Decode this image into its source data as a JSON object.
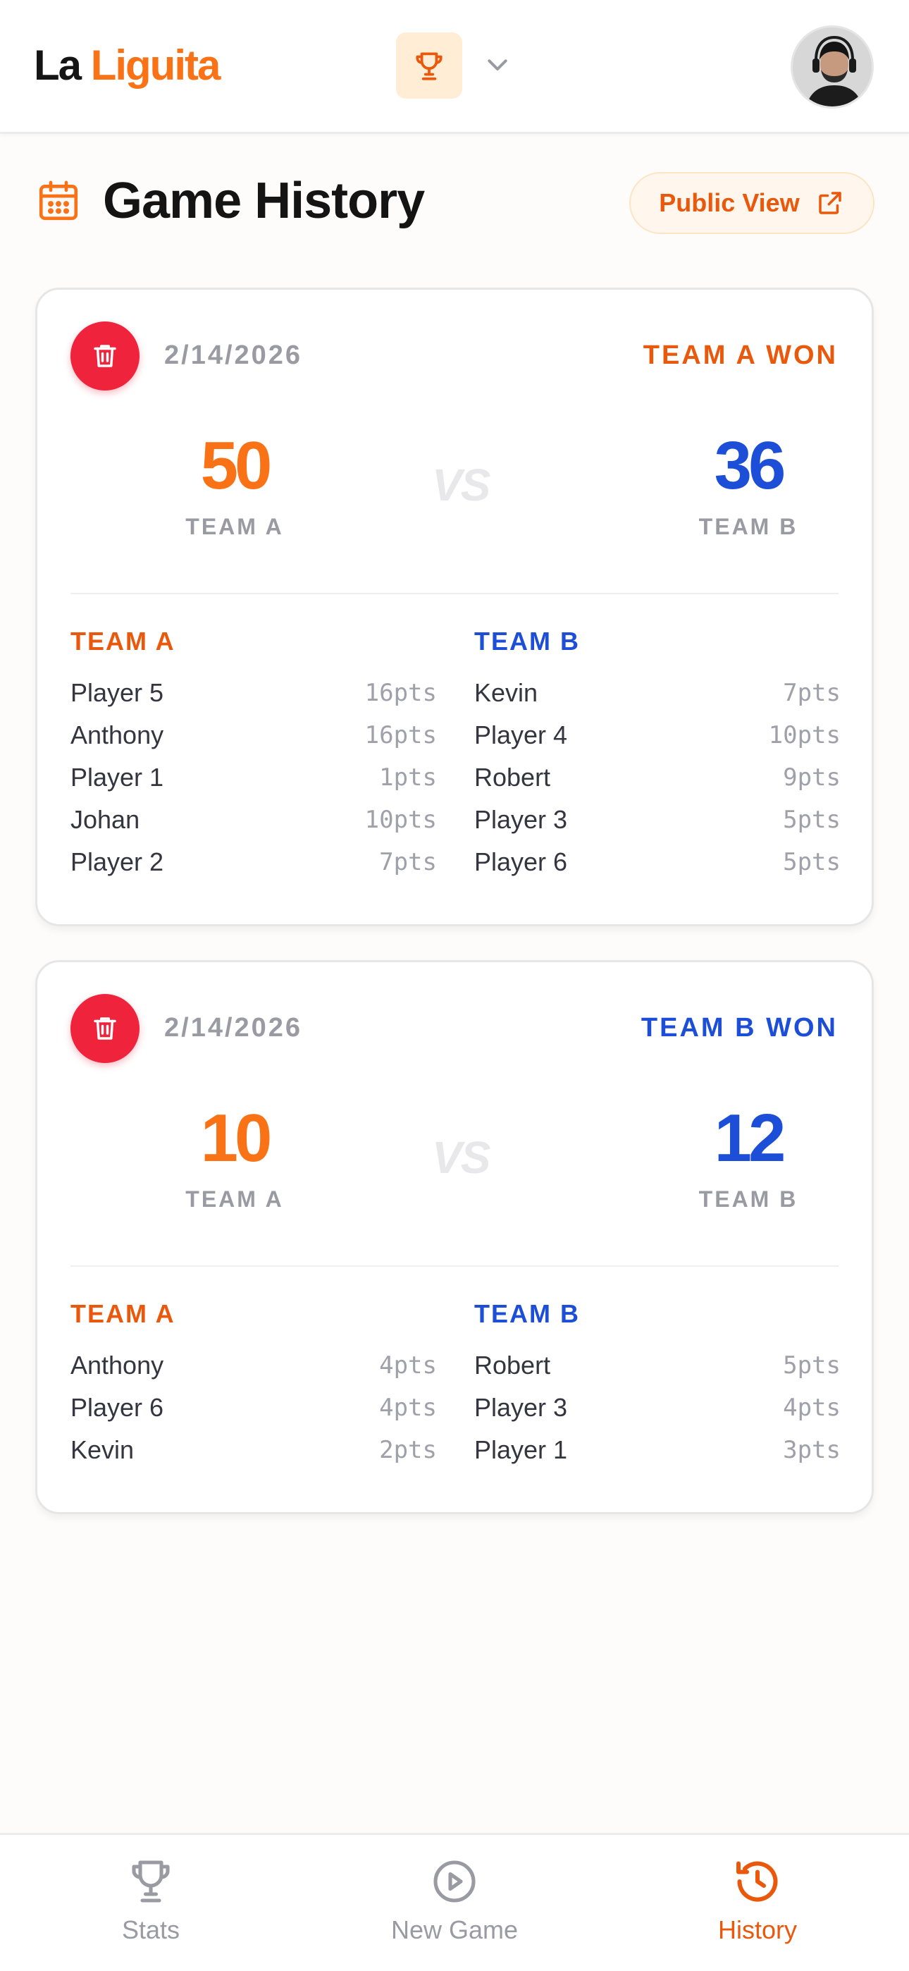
{
  "header": {
    "brand_part1": "La",
    "brand_part2": "Liguita"
  },
  "page": {
    "title": "Game History",
    "public_view_label": "Public View"
  },
  "games": [
    {
      "date": "2/14/2026",
      "result": "TEAM A WON",
      "score_a": "50",
      "score_b": "36",
      "label_a": "TEAM A",
      "label_b": "TEAM B",
      "vs": "VS",
      "team_a_title": "TEAM A",
      "team_b_title": "TEAM B",
      "team_a": [
        {
          "name": "Player 5",
          "pts": "16pts"
        },
        {
          "name": "Anthony",
          "pts": "16pts"
        },
        {
          "name": "Player 1",
          "pts": "1pts"
        },
        {
          "name": "Johan",
          "pts": "10pts"
        },
        {
          "name": "Player 2",
          "pts": "7pts"
        }
      ],
      "team_b": [
        {
          "name": "Kevin",
          "pts": "7pts"
        },
        {
          "name": "Player 4",
          "pts": "10pts"
        },
        {
          "name": "Robert",
          "pts": "9pts"
        },
        {
          "name": "Player 3",
          "pts": "5pts"
        },
        {
          "name": "Player 6",
          "pts": "5pts"
        }
      ]
    },
    {
      "date": "2/14/2026",
      "result": "TEAM B WON",
      "score_a": "10",
      "score_b": "12",
      "label_a": "TEAM A",
      "label_b": "TEAM B",
      "vs": "VS",
      "team_a_title": "TEAM A",
      "team_b_title": "TEAM B",
      "team_a": [
        {
          "name": "Anthony",
          "pts": "4pts"
        },
        {
          "name": "Player 6",
          "pts": "4pts"
        },
        {
          "name": "Kevin",
          "pts": "2pts"
        }
      ],
      "team_b": [
        {
          "name": "Robert",
          "pts": "5pts"
        },
        {
          "name": "Player 3",
          "pts": "4pts"
        },
        {
          "name": "Player 1",
          "pts": "3pts"
        }
      ]
    }
  ],
  "nav": {
    "stats": "Stats",
    "new_game": "New Game",
    "history": "History"
  },
  "icons": {
    "league": "trophy-icon",
    "avatar": "user-avatar",
    "title": "calendar-icon",
    "public_view": "external-link-icon",
    "delete": "trash-icon",
    "nav_stats": "trophy-icon",
    "nav_new_game": "play-circle-icon",
    "nav_history": "history-icon"
  },
  "colors": {
    "accent_orange": "#ea580c",
    "score_orange": "#f97316",
    "team_blue": "#1d4ed8",
    "delete_red": "#ef233c",
    "muted": "#9a9aa3"
  }
}
